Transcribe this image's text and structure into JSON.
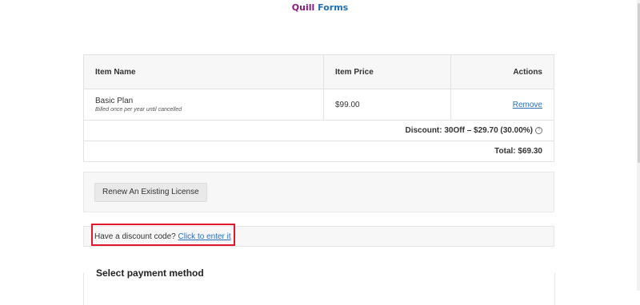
{
  "brand": {
    "part1": "Quill",
    "part2": "Forms",
    "color1": "#8a1a80",
    "color2": "#1f6fb3"
  },
  "cart": {
    "headers": {
      "name": "Item Name",
      "price": "Item Price",
      "actions": "Actions"
    },
    "item": {
      "name": "Basic Plan",
      "subtitle": "Billed once per year until cancelled",
      "price": "$99.00",
      "remove_label": "Remove"
    },
    "discount_text": "Discount:  30Off – $29.70 (30.00%)",
    "discount_info_icon": "info-icon",
    "total_text": "Total: $69.30"
  },
  "renew": {
    "button_label": "Renew An Existing License"
  },
  "coupon": {
    "prompt": "Have a discount code?",
    "link": "Click to enter it"
  },
  "payment": {
    "title": "Select payment method"
  },
  "colors": {
    "link": "#2a6fb8",
    "highlight": "#e0182d"
  }
}
